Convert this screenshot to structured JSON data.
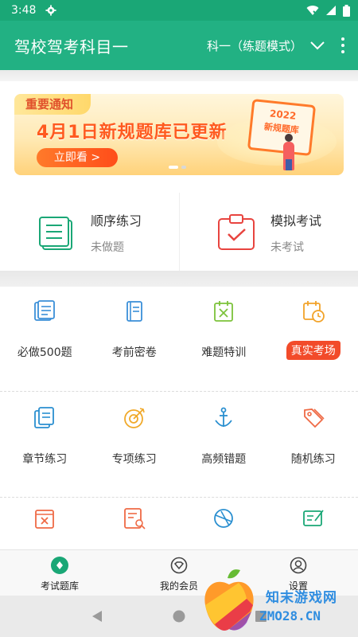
{
  "status_bar": {
    "time": "3:48"
  },
  "app_bar": {
    "title": "驾校驾考科目一",
    "mode": "科一（练题模式）"
  },
  "banner": {
    "tag": "重要通知",
    "headline": "4月1日新规题库已更新",
    "cta": "立即看 >",
    "sign_year": "2022",
    "sign_text": "新规题库"
  },
  "practice": [
    {
      "name": "顺序练习",
      "status": "未做题"
    },
    {
      "name": "模拟考试",
      "status": "未考试"
    }
  ],
  "grid": {
    "row1": [
      "必做500题",
      "考前密卷",
      "难题特训",
      "真实考场"
    ],
    "row2": [
      "章节练习",
      "专项练习",
      "高频错题",
      "随机练习"
    ]
  },
  "bottom_nav": [
    {
      "label": "考试题库",
      "active": true
    },
    {
      "label": "我的会员",
      "active": false
    },
    {
      "label": "设置",
      "active": false
    }
  ],
  "watermark": {
    "title": "知末游戏网",
    "url": "ZMO28.CN"
  },
  "colors": {
    "primary": "#22b183",
    "accent": "#ff5a1f",
    "hot": "#f24b2a"
  }
}
